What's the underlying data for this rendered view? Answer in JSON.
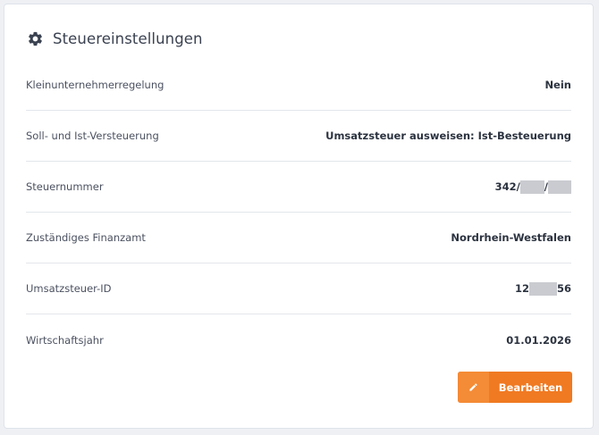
{
  "card": {
    "title": "Steuereinstellungen",
    "icon": "gear-icon"
  },
  "rows": [
    {
      "label": "Kleinunternehmerregelung",
      "value": "Nein"
    },
    {
      "label": "Soll- und Ist-Versteuerung",
      "value": "Umsatzsteuer ausweisen: Ist-Besteuerung"
    },
    {
      "label": "Steuernummer",
      "value_prefix": "342/",
      "value_middle": "/",
      "value_suffix": ""
    },
    {
      "label": "Zuständiges Finanzamt",
      "value": "Nordrhein-Westfalen"
    },
    {
      "label": "Umsatzsteuer-ID",
      "value_prefix": "12",
      "value_suffix": "56"
    },
    {
      "label": "Wirtschaftsjahr",
      "value": "01.01.2026"
    }
  ],
  "actions": {
    "edit_label": "Bearbeiten",
    "edit_icon": "pencil-icon"
  },
  "colors": {
    "accent": "#f07a22",
    "accent_light": "#f48b36",
    "icon": "#3a4150",
    "redacted": "#c9cbd0"
  }
}
